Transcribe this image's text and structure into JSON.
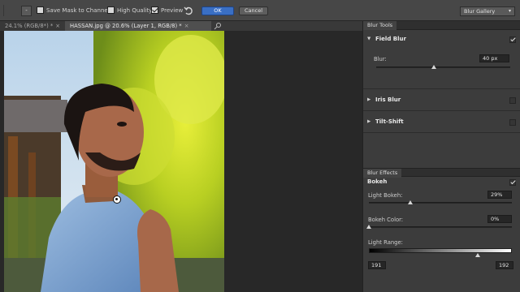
{
  "options_bar": {
    "mode_dropdown_symbol": "-",
    "save_mask_label": "Save Mask to Channels",
    "save_mask_checked": false,
    "high_quality_label": "High Quality",
    "high_quality_checked": false,
    "preview_label": "Preview",
    "preview_checked": true,
    "ok_label": "OK",
    "cancel_label": "Cancel",
    "workspace_label": "Blur Gallery",
    "workspace_chevron": "▾"
  },
  "tabs": [
    {
      "label": "24.1% (RGB/8*) *",
      "close": "×",
      "active": false
    },
    {
      "label": "HASSAN.jpg @ 20.6% (Layer 1, RGB/8) *",
      "close": "×",
      "active": true
    }
  ],
  "blur_tools": {
    "panel_title": "Blur Tools",
    "field_blur": {
      "label": "Field Blur",
      "expanded": true,
      "checked": true,
      "blur_label": "Blur:",
      "blur_value": "40 px",
      "blur_fraction": 0.43
    },
    "iris_blur": {
      "label": "Iris Blur",
      "expanded": false,
      "checked": false
    },
    "tilt_shift": {
      "label": "Tilt-Shift",
      "expanded": false,
      "checked": false
    }
  },
  "blur_effects": {
    "panel_title": "Blur Effects",
    "bokeh_label": "Bokeh",
    "bokeh_checked": true,
    "light_bokeh_label": "Light Bokeh:",
    "light_bokeh_value": "29%",
    "light_bokeh_fraction": 0.29,
    "bokeh_color_label": "Bokeh Color:",
    "bokeh_color_value": "0%",
    "bokeh_color_fraction": 0.0,
    "light_range_label": "Light Range:",
    "light_range_low": "191",
    "light_range_high": "192"
  },
  "colors": {
    "accent_button": "#3a6fc4",
    "panel_bg": "#3c3c3c",
    "canvas_bg": "#282828"
  }
}
